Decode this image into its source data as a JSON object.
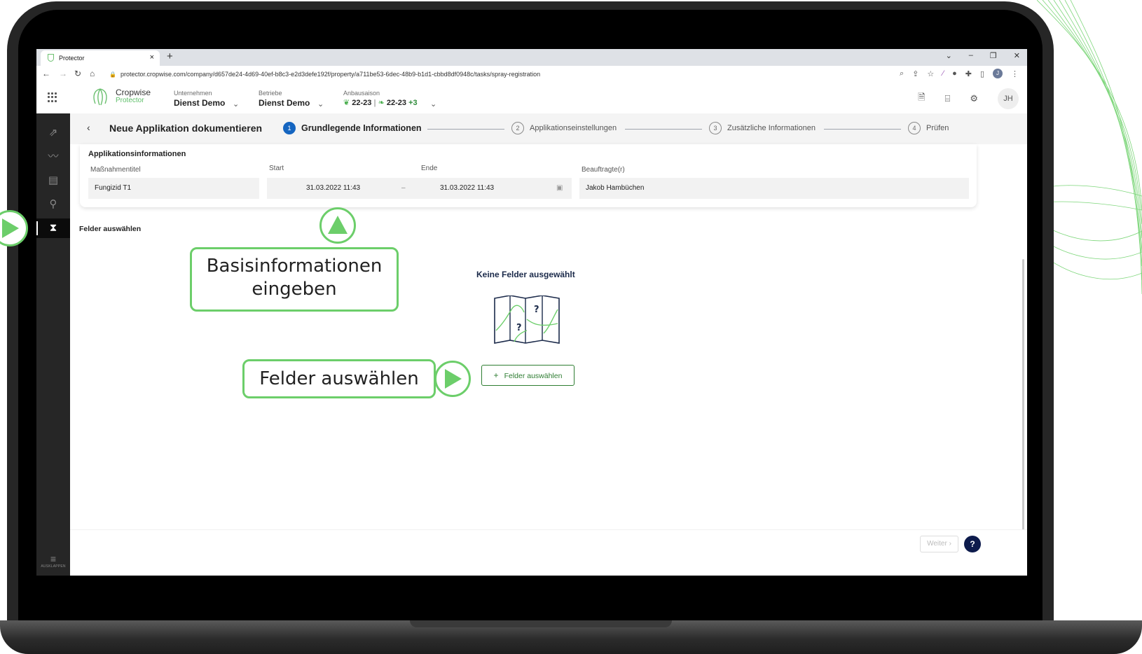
{
  "browser": {
    "tab_title": "Protector",
    "tab_close": "×",
    "new_tab": "+",
    "url": "protector.cropwise.com/company/d657de24-4d69-40ef-b8c3-e2d3defe192f/property/a711be53-6dec-48b9-b1d1-cbbd8df0948c/tasks/spray-registration",
    "profile_initial": "J"
  },
  "header": {
    "brand": "Cropwise",
    "brand_sub": "Protector",
    "company_label": "Unternehmen",
    "company_value": "Dienst Demo",
    "property_label": "Betriebe",
    "property_value": "Dienst Demo",
    "season_label": "Anbausaison",
    "season_1": "22-23",
    "season_2": "22-23",
    "season_more": "+3",
    "user_initials": "JH"
  },
  "stepper": {
    "title": "Neue Applikation dokumentieren",
    "steps": [
      {
        "num": "1",
        "label": "Grundlegende Informationen"
      },
      {
        "num": "2",
        "label": "Applikationseinstellungen"
      },
      {
        "num": "3",
        "label": "Zusätzliche Informationen"
      },
      {
        "num": "4",
        "label": "Prüfen"
      }
    ]
  },
  "form": {
    "section_title": "Applikationsinformationen",
    "title_label": "Maßnahmentitel",
    "title_value": "Fungizid T1",
    "start_label": "Start",
    "start_value": "31.03.2022  11:43",
    "range_sep": "–",
    "end_label": "Ende",
    "end_value": "31.03.2022  11:43",
    "assignee_label": "Beauftragte(r)",
    "assignee_value": "Jakob Hambüchen"
  },
  "fields": {
    "heading": "Felder auswählen",
    "empty_title": "Keine Felder ausgewählt",
    "button_label": "Felder auswählen",
    "button_icon": "+"
  },
  "footer": {
    "next_label": "Weiter ›",
    "help": "?"
  },
  "sidebar": {
    "collapse_label": "AUSKLAPPEN"
  },
  "annotations": {
    "callout_1": [
      "Basisinformationen",
      "eingeben"
    ],
    "callout_2": "Felder auswählen"
  },
  "colors": {
    "accent_green": "#6cce6a",
    "primary_blue": "#1565c0",
    "button_green": "#2e7d32",
    "help_navy": "#0d1b4c"
  }
}
